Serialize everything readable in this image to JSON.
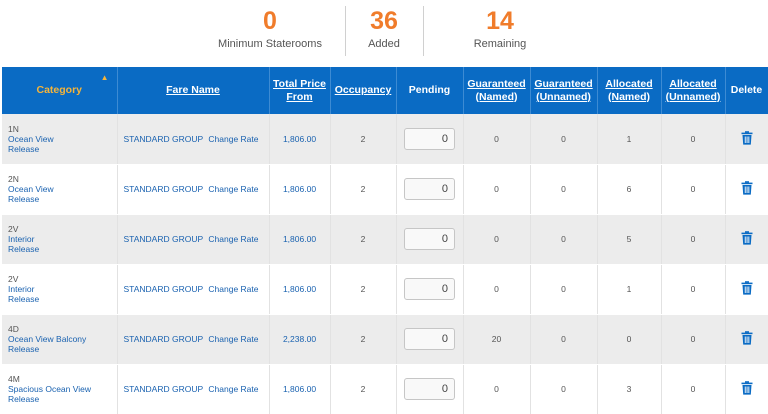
{
  "stats": {
    "minimum": {
      "value": "0",
      "label": "Minimum Staterooms"
    },
    "added": {
      "value": "36",
      "label": "Added"
    },
    "remaining": {
      "value": "14",
      "label": "Remaining"
    }
  },
  "table": {
    "headers": {
      "category": "Category",
      "fare_name": "Fare Name",
      "total_price": "Total Price From",
      "occupancy": "Occupancy",
      "pending": "Pending",
      "guaranteed_named": "Guaranteed (Named)",
      "guaranteed_unnamed": "Guaranteed (Unnamed)",
      "allocated_named": "Allocated (Named)",
      "allocated_unnamed": "Allocated (Unnamed)",
      "delete": "Delete"
    },
    "rows": [
      {
        "code": "1N",
        "name": "Ocean View",
        "release": "Release",
        "fare": "STANDARD GROUP",
        "change": "Change Rate",
        "price": "1,806.00",
        "occupancy": "2",
        "pending": "0",
        "gn": "0",
        "gu": "0",
        "an": "1",
        "au": "0"
      },
      {
        "code": "2N",
        "name": "Ocean View",
        "release": "Release",
        "fare": "STANDARD GROUP",
        "change": "Change Rate",
        "price": "1,806.00",
        "occupancy": "2",
        "pending": "0",
        "gn": "0",
        "gu": "0",
        "an": "6",
        "au": "0"
      },
      {
        "code": "2V",
        "name": "Interior",
        "release": "Release",
        "fare": "STANDARD GROUP",
        "change": "Change Rate",
        "price": "1,806.00",
        "occupancy": "2",
        "pending": "0",
        "gn": "0",
        "gu": "0",
        "an": "5",
        "au": "0"
      },
      {
        "code": "2V",
        "name": "Interior",
        "release": "Release",
        "fare": "STANDARD GROUP",
        "change": "Change Rate",
        "price": "1,806.00",
        "occupancy": "2",
        "pending": "0",
        "gn": "0",
        "gu": "0",
        "an": "1",
        "au": "0"
      },
      {
        "code": "4D",
        "name": "Ocean View Balcony",
        "release": "Release",
        "fare": "STANDARD GROUP",
        "change": "Change Rate",
        "price": "2,238.00",
        "occupancy": "2",
        "pending": "0",
        "gn": "20",
        "gu": "0",
        "an": "0",
        "au": "0"
      },
      {
        "code": "4M",
        "name": "Spacious Ocean View",
        "release": "Release",
        "fare": "STANDARD GROUP",
        "change": "Change Rate",
        "price": "1,806.00",
        "occupancy": "2",
        "pending": "0",
        "gn": "0",
        "gu": "0",
        "an": "3",
        "au": "0"
      }
    ]
  },
  "icons": {
    "sort": "sort-ascending-icon",
    "delete": "trash-icon"
  },
  "colors": {
    "header_bg": "#0a6bc4",
    "accent_orange": "#f07c2b",
    "link": "#1a62b0",
    "row_alt": "#ececec"
  }
}
